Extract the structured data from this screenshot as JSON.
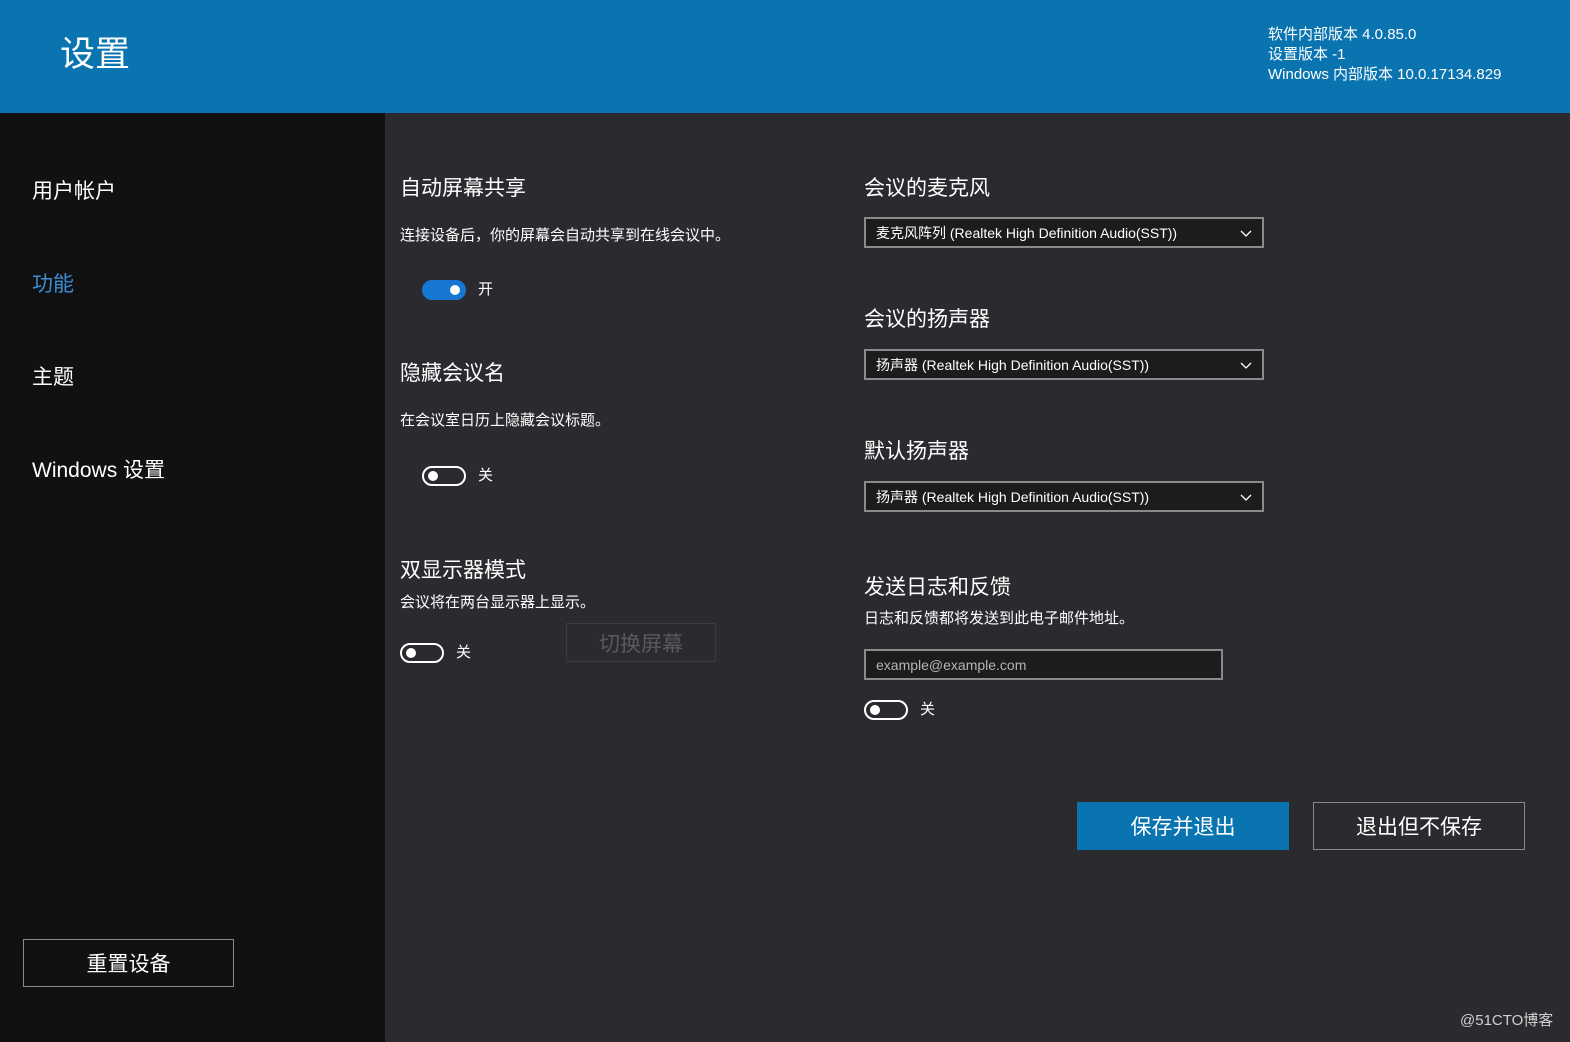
{
  "header": {
    "title": "设置",
    "version_lines": [
      "软件内部版本 4.0.85.0",
      "设置版本 -1",
      "Windows 内部版本 10.0.17134.829"
    ]
  },
  "sidebar": {
    "items": [
      {
        "label": "用户帐户",
        "active": false
      },
      {
        "label": "功能",
        "active": true
      },
      {
        "label": "主题",
        "active": false
      },
      {
        "label": "Windows 设置",
        "active": false
      }
    ],
    "reset_button": "重置设备"
  },
  "features": {
    "auto_share": {
      "title": "自动屏幕共享",
      "description": "连接设备后，你的屏幕会自动共享到在线会议中。",
      "toggle_on": true,
      "toggle_label": "开"
    },
    "hide_meeting_name": {
      "title": "隐藏会议名",
      "description": "在会议室日历上隐藏会议标题。",
      "toggle_on": false,
      "toggle_label": "关"
    },
    "dual_monitor": {
      "title": "双显示器模式",
      "description": "会议将在两台显示器上显示。",
      "toggle_on": false,
      "toggle_label": "关",
      "switch_screen_button": "切换屏幕",
      "switch_screen_disabled": true
    },
    "meeting_microphone": {
      "title": "会议的麦克风",
      "selected": "麦克风阵列 (Realtek High Definition Audio(SST))"
    },
    "meeting_speaker": {
      "title": "会议的扬声器",
      "selected": "扬声器 (Realtek High Definition Audio(SST))"
    },
    "default_speaker": {
      "title": "默认扬声器",
      "selected": "扬声器 (Realtek High Definition Audio(SST))"
    },
    "send_logs": {
      "title": "发送日志和反馈",
      "description": "日志和反馈都将发送到此电子邮件地址。",
      "email_placeholder": "example@example.com",
      "toggle_on": false,
      "toggle_label": "关"
    }
  },
  "actions": {
    "save_exit": "保存并退出",
    "exit_no_save": "退出但不保存"
  },
  "watermark": "@51CTO博客",
  "colors": {
    "header_bg": "#0a74b1",
    "sidebar_bg": "#111111",
    "main_bg": "#2b2b2f",
    "accent": "#0a74b1",
    "active_nav": "#3a8ed6",
    "toggle_on": "#1677d2"
  }
}
